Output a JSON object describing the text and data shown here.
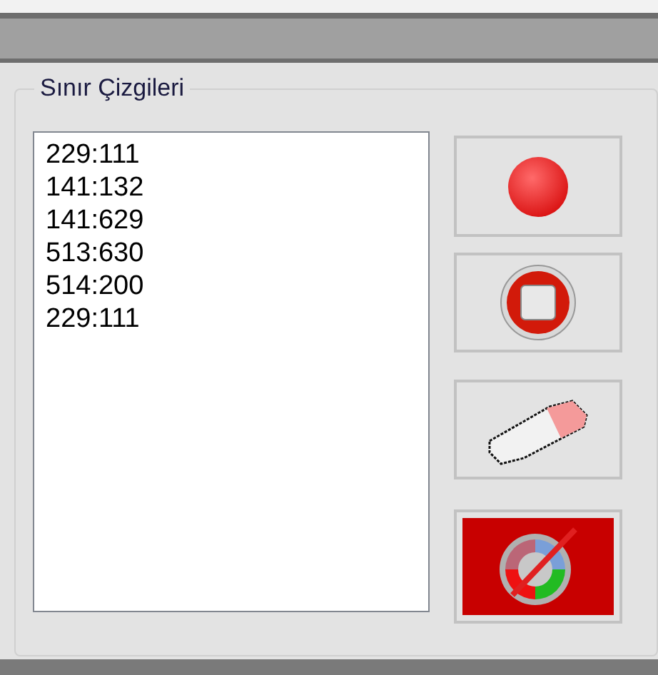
{
  "group": {
    "title": "Sınır Çizgileri"
  },
  "list": {
    "items": [
      "229:111",
      "141:132",
      "141:629",
      "513:630",
      "514:200",
      "229:111"
    ]
  },
  "buttons": [
    {
      "kind": "record"
    },
    {
      "kind": "stop"
    },
    {
      "kind": "erase"
    },
    {
      "kind": "color",
      "color": "#c80000"
    }
  ]
}
